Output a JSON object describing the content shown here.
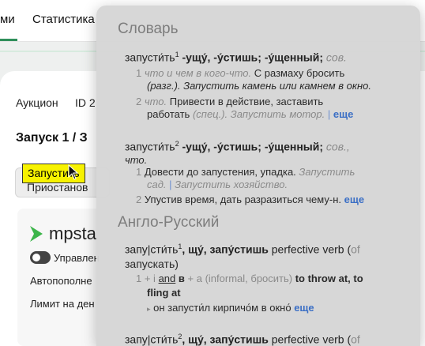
{
  "nav": {
    "tab_active": "ми",
    "tab_stats": "Статистика"
  },
  "campaign": {
    "auction_label": "Аукцион",
    "id_label": "ID 2",
    "launch_title": "Запуск 1 / З",
    "launch_button_label": "Приостанов",
    "tooltip": "Запустить"
  },
  "card": {
    "logo_text": "mpsta",
    "toggle_label": "Управлен",
    "autofill_label": "Автопополне",
    "limit_label": "Лимит на ден"
  },
  "dictionary": {
    "section1": "Словарь",
    "entry1": {
      "word": "запусти́ть",
      "sup": "1",
      "forms": "-ущу́, -у́стишь; -у́щенный;",
      "pos": "сов.",
      "s1_num": "1",
      "s1_a": "что и чем в кого-что.",
      "s1_b": "С размаху бросить",
      "s1_c": "(разг.). Запустить камень или камнем в окно.",
      "s2_num": "2",
      "s2_a": "что.",
      "s2_b": "Привести в действие, заставить",
      "s2_c": "работать",
      "s2_d": "(спец.). Запустить мотор.",
      "sep": "|",
      "more": "еще"
    },
    "entry2": {
      "word": "запусти́ть",
      "sup": "2",
      "forms": "-ущу́, -у́стишь; -у́щенный;",
      "pos": "сов.,",
      "pos2": "что.",
      "s1_num": "1",
      "s1_a": "Довести до запустения, упадка.",
      "s1_b": "Запустить",
      "s1_c": "сад.",
      "s1_d": "Запустить хозяйство.",
      "sep": "|",
      "s2_num": "2",
      "s2_a": "Упустив время, дать разразиться чему-н.",
      "more": "еще"
    },
    "section2": "Англо-Русский",
    "entry3": {
      "word": "запу|сти́ть",
      "sup": "1",
      "forms": ", щу́, запу́стишь",
      "pos": "perfective verb (",
      "of": "of",
      "l2": "запускать)",
      "n1": "1 + i",
      "and": "and",
      "in": "в",
      "plus_a": "+ a",
      "informal": "(informal, бросить)",
      "trans1": "to throw at, to",
      "trans2": "fling at",
      "ex_bullet": "▸",
      "example": "он запусти́л кирпичо́м в окно́",
      "more": "еще"
    },
    "entry4": {
      "word": "запу|сти́ть",
      "sup": "2",
      "forms": ", щу́, запу́стишь",
      "pos": "perfective verb (",
      "of": "of"
    }
  }
}
